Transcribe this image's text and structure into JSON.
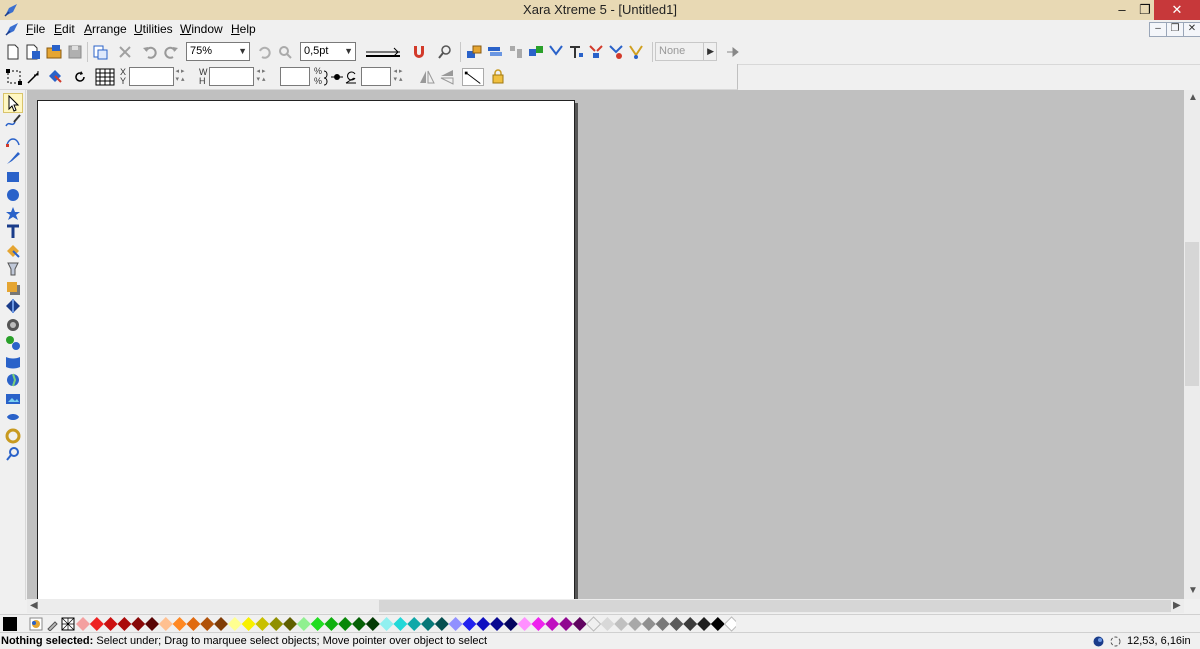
{
  "window": {
    "title": "Xara Xtreme 5 - [Untitled1]",
    "minimize": "–",
    "restore": "❐",
    "close": "✕"
  },
  "menu": {
    "items": [
      {
        "underline": "F",
        "rest": "ile"
      },
      {
        "underline": "E",
        "rest": "dit"
      },
      {
        "underline": "A",
        "rest": "rrange"
      },
      {
        "underline": "U",
        "rest": "tilities"
      },
      {
        "underline": "W",
        "rest": "indow"
      },
      {
        "underline": "H",
        "rest": "elp"
      }
    ],
    "mdi_minimize": "–",
    "mdi_restore": "❐",
    "mdi_close": "✕"
  },
  "toolbar": {
    "zoom_value": "75%",
    "line_width_value": "0,5pt",
    "quality_value": "None"
  },
  "infobar": {
    "x_label": "X",
    "y_label": "Y",
    "w_label": "W",
    "h_label": "H",
    "pct_top": "%",
    "pct_bottom": "%",
    "x_value": "",
    "y_value": "",
    "w_value": "",
    "h_value": "",
    "scale_value": "",
    "angle_value": ""
  },
  "tools": [
    "selector-tool-icon",
    "freehand-tool-icon",
    "bezier-tool-icon",
    "pen-tool-icon",
    "rectangle-tool-icon",
    "ellipse-tool-icon",
    "quickshape-tool-icon",
    "text-tool-icon",
    "fill-tool-icon",
    "transparency-tool-icon",
    "shadow-tool-icon",
    "bevel-tool-icon",
    "contour-tool-icon",
    "blend-tool-icon",
    "mould-tool-icon",
    "live-effects-tool-icon",
    "photo-tool-icon",
    "push-tool-icon",
    "feather-tool-icon",
    "zoom-tool-icon"
  ],
  "colors": {
    "palette": [
      "#f4a0a0",
      "#ee2222",
      "#cc1111",
      "#aa0a0a",
      "#880808",
      "#5a0505",
      "#ffc090",
      "#ff8822",
      "#e06a10",
      "#b0520a",
      "#803c06",
      "#ffff90",
      "#f8f000",
      "#c8c000",
      "#909000",
      "#606000",
      "#90f090",
      "#22dd22",
      "#10b010",
      "#088808",
      "#056005",
      "#033a03",
      "#90f0f0",
      "#22d8d8",
      "#10a8a8",
      "#087878",
      "#055050",
      "#9090ff",
      "#2222ee",
      "#1010c0",
      "#080890",
      "#050560",
      "#ff90ff",
      "#ee22ee",
      "#c010c0",
      "#900890",
      "#600560",
      "#f0f0f0",
      "#d8d8d8",
      "#c0c0c0",
      "#a8a8a8",
      "#909090",
      "#787878",
      "#5a5a5a",
      "#3c3c3c",
      "#1e1e1e",
      "#000000",
      "#ffffff"
    ]
  },
  "status": {
    "bold": "Nothing selected:",
    "message": " Select under; Drag to marquee select objects; Move pointer over object to select",
    "coords": "12,53, 6,16in"
  }
}
